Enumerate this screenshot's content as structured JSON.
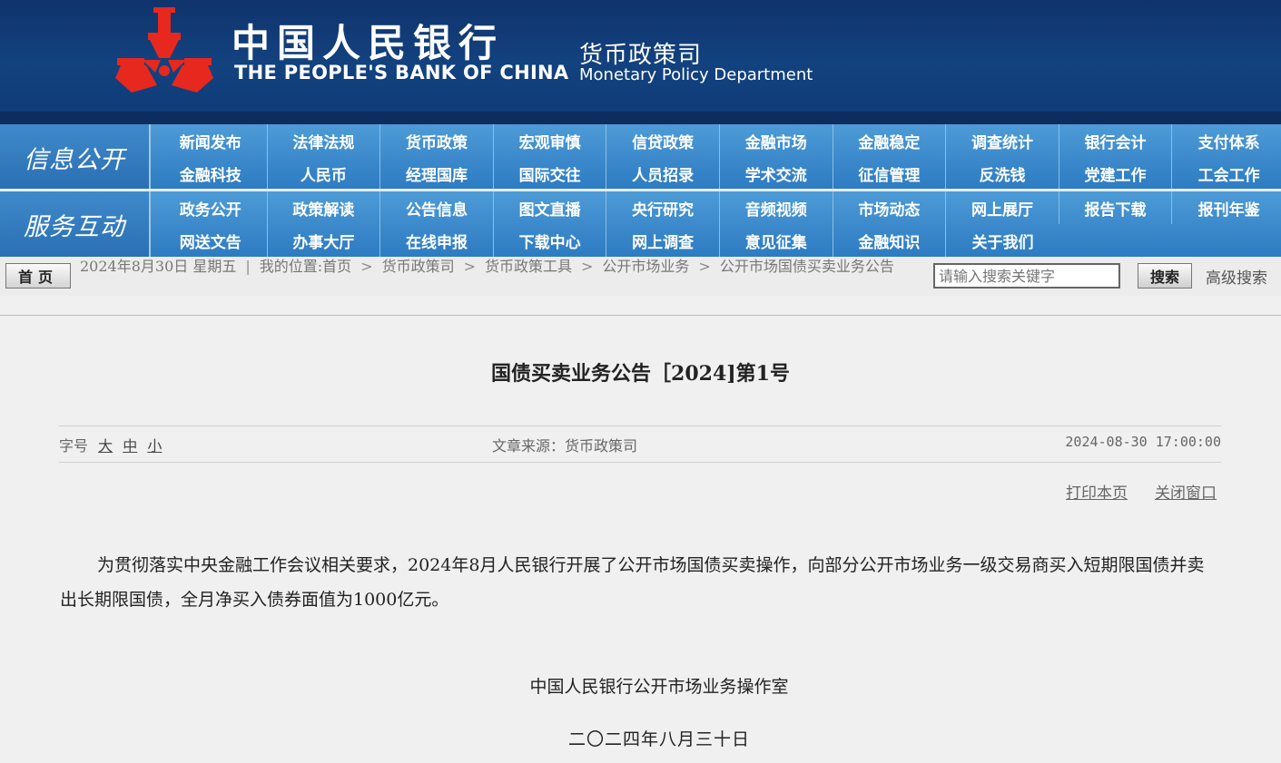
{
  "header": {
    "bank_name_cn": "中国人民银行",
    "bank_name_en": "THE PEOPLE'S BANK OF CHINA",
    "dept_name_cn": "货币政策司",
    "dept_name_en": "Monetary Policy Department",
    "logo_color": "#e6281e"
  },
  "nav_info": {
    "title": "信息公开",
    "row1": [
      "新闻发布",
      "法律法规",
      "货币政策",
      "宏观审慎",
      "信贷政策",
      "金融市场",
      "金融稳定",
      "调查统计",
      "银行会计",
      "支付体系"
    ],
    "row2": [
      "金融科技",
      "人民币",
      "经理国库",
      "国际交往",
      "人员招录",
      "学术交流",
      "征信管理",
      "反洗钱",
      "党建工作",
      "工会工作"
    ]
  },
  "nav_service": {
    "title": "服务互动",
    "row1": [
      "政务公开",
      "政策解读",
      "公告信息",
      "图文直播",
      "央行研究",
      "音频视频",
      "市场动态",
      "网上展厅",
      "报告下载",
      "报刊年鉴"
    ],
    "row2": [
      "网送文告",
      "办事大厅",
      "在线申报",
      "下载中心",
      "网上调查",
      "意见征集",
      "金融知识",
      "关于我们"
    ]
  },
  "crumbbar": {
    "home_label": "首页",
    "date": "2024年8月30日  星期五",
    "location_label": "我的位置:首页",
    "crumbs": [
      "货币政策司",
      "货币政策工具",
      "公开市场业务",
      "公开市场国债买卖业务公告"
    ],
    "search_placeholder": "请输入搜索关键字",
    "search_button": "搜索",
    "advanced_search": "高级搜索"
  },
  "article": {
    "title": "国债买卖业务公告［2024]第1号",
    "font_size_label": "字号",
    "font_sizes": [
      "大",
      "中",
      "小"
    ],
    "source": "文章来源：货币政策司",
    "date": "2024-08-30 17:00:00",
    "print": "打印本页",
    "close": "关闭窗口",
    "body": "为贯彻落实中央金融工作会议相关要求，2024年8月人民银行开展了公开市场国债买卖操作，向部分公开市场业务一级交易商买入短期限国债并卖出长期限国债，全月净买入债券面值为1000亿元。",
    "signature": "中国人民银行公开市场业务操作室",
    "sign_date": "二〇二四年八月三十日"
  }
}
